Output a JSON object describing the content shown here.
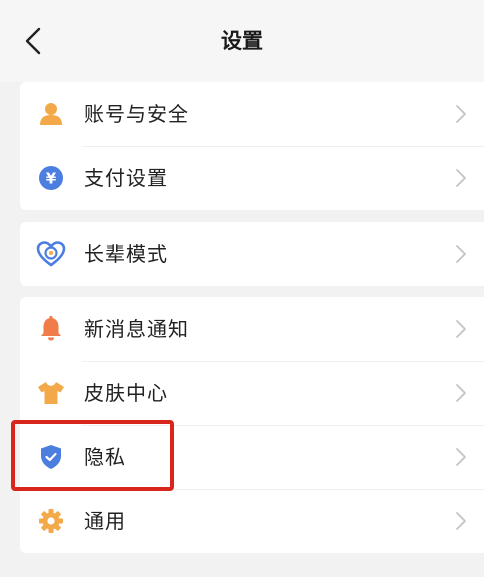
{
  "header": {
    "title": "设置",
    "back_icon": "chevron-left-icon"
  },
  "groups": [
    {
      "items": [
        {
          "label": "账号与安全",
          "icon": "user-icon",
          "color": "#f3a94a"
        },
        {
          "label": "支付设置",
          "icon": "yuan-coin-icon",
          "color": "#4c7ee0",
          "glyph": "¥"
        }
      ]
    },
    {
      "items": [
        {
          "label": "长辈模式",
          "icon": "heart-smile-icon",
          "color": "#4c7ee0"
        }
      ]
    },
    {
      "items": [
        {
          "label": "新消息通知",
          "icon": "bell-icon",
          "color": "#f07c4a"
        },
        {
          "label": "皮肤中心",
          "icon": "shirt-icon",
          "color": "#f3a94a"
        },
        {
          "label": "隐私",
          "icon": "shield-check-icon",
          "color": "#4c7ee0"
        },
        {
          "label": "通用",
          "icon": "gear-icon",
          "color": "#f3a94a"
        }
      ]
    }
  ],
  "highlight": {
    "target": "隐私",
    "color": "#d9261c"
  }
}
